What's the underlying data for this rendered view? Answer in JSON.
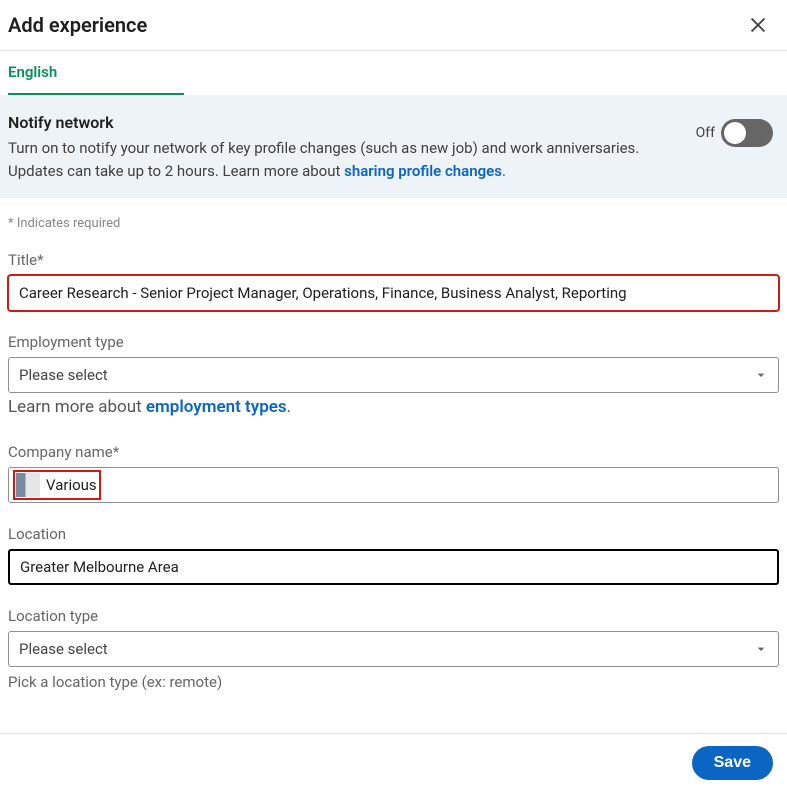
{
  "header": {
    "title": "Add experience"
  },
  "tab": {
    "label": "English"
  },
  "notify": {
    "title": "Notify network",
    "desc_part1": "Turn on to notify your network of key profile changes (such as new job) and work anniversaries. Updates can take up to 2 hours. Learn more about ",
    "link": "sharing profile changes",
    "period": ".",
    "toggle_label": "Off"
  },
  "required_note": "* Indicates required",
  "title_field": {
    "label": "Title*",
    "value": "Career Research - Senior Project Manager, Operations, Finance, Business Analyst, Reporting"
  },
  "employment_type": {
    "label": "Employment type",
    "placeholder": "Please select",
    "learn_prefix": "Learn more about ",
    "learn_link": "employment types",
    "learn_period": "."
  },
  "company": {
    "label": "Company name*",
    "value": "Various"
  },
  "location": {
    "label": "Location",
    "value": "Greater Melbourne Area"
  },
  "location_type": {
    "label": "Location type",
    "placeholder": "Please select",
    "hint": "Pick a location type (ex: remote)"
  },
  "footer": {
    "save": "Save"
  }
}
